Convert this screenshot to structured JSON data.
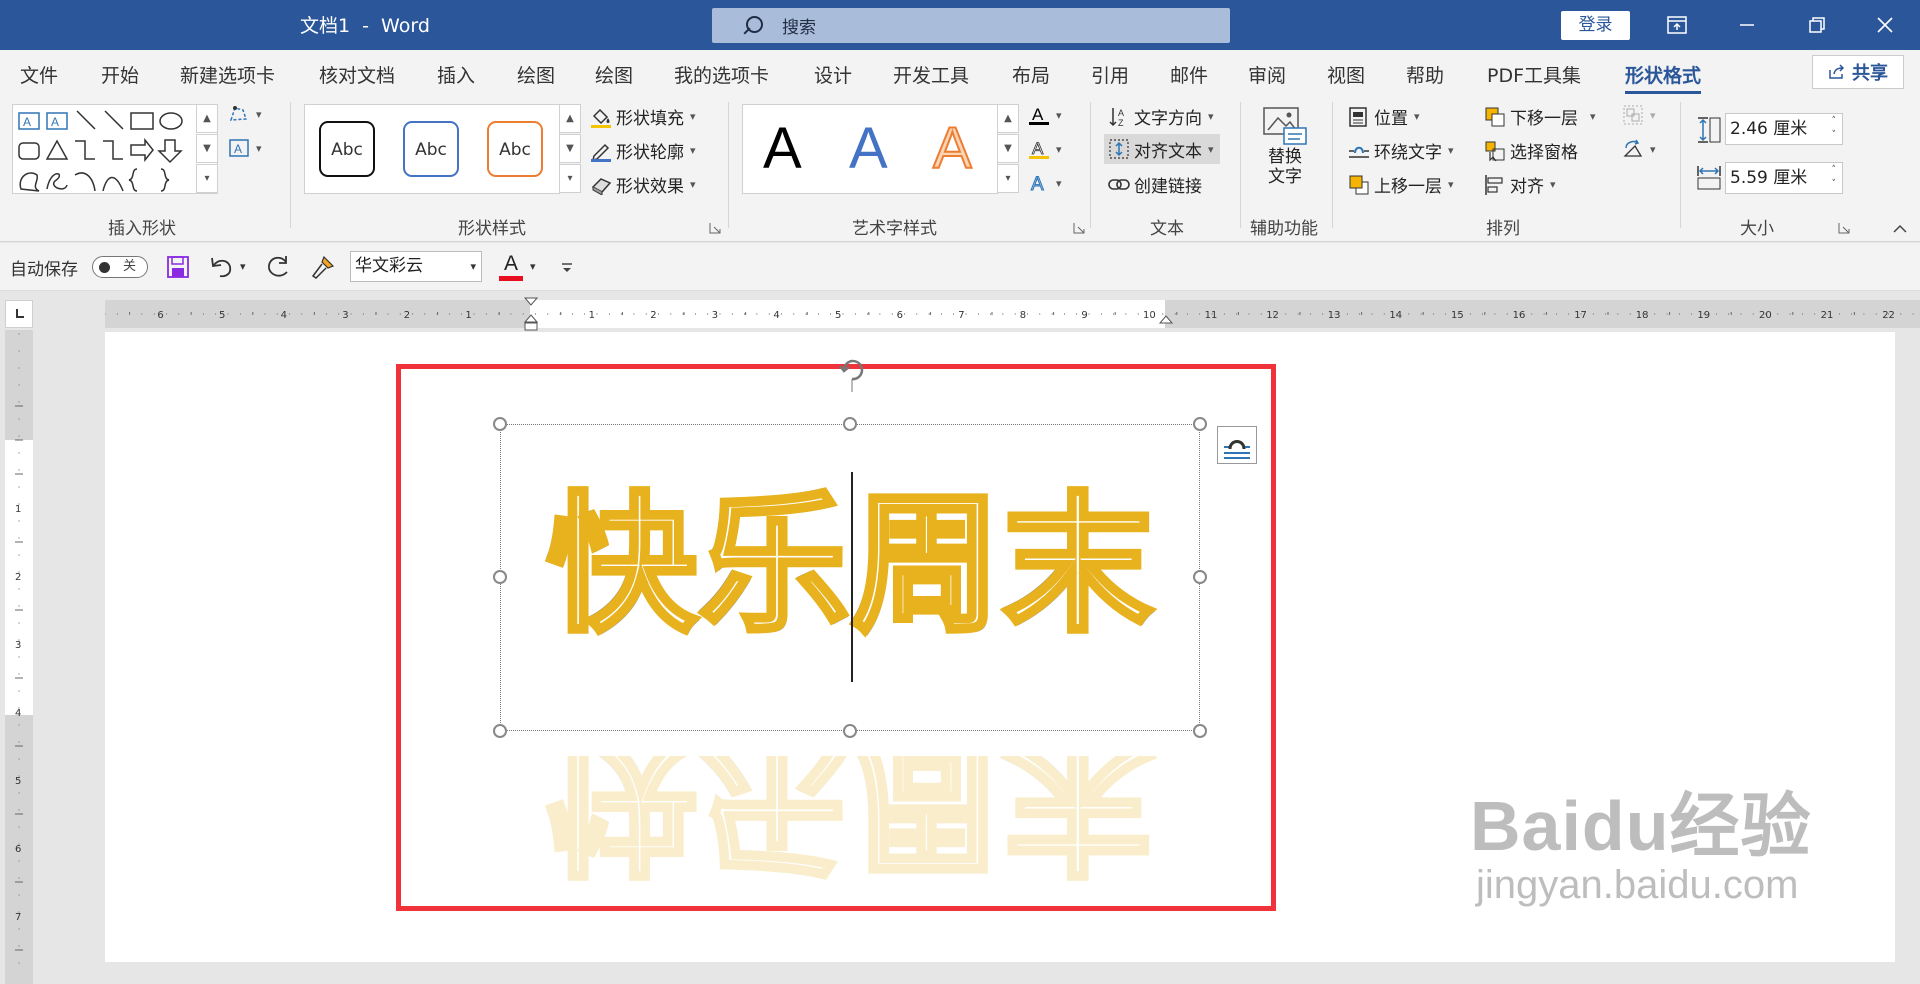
{
  "titlebar": {
    "doc_name": "文档1",
    "separator": "-",
    "app_name": "Word",
    "search_placeholder": "搜索",
    "login": "登录"
  },
  "menu": {
    "tabs": [
      "文件",
      "开始",
      "新建选项卡",
      "核对文档",
      "插入",
      "绘图",
      "绘图",
      "我的选项卡",
      "设计",
      "开发工具",
      "布局",
      "引用",
      "邮件",
      "审阅",
      "视图",
      "帮助",
      "PDF工具集",
      "形状格式"
    ],
    "active_tab": "形状格式",
    "share": "共享"
  },
  "ribbon": {
    "insert_shapes": {
      "label": "插入形状"
    },
    "shape_styles": {
      "label": "形状样式",
      "presets": [
        "Abc",
        "Abc",
        "Abc"
      ],
      "fill": "形状填充",
      "outline": "形状轮廓",
      "effects": "形状效果"
    },
    "wordart_styles": {
      "label": "艺术字样式",
      "presets": [
        "A",
        "A",
        "A"
      ]
    },
    "text": {
      "label": "文本",
      "direction": "文字方向",
      "align": "对齐文本",
      "link": "创建链接"
    },
    "accessibility": {
      "label": "辅助功能",
      "alt_text_line1": "替换",
      "alt_text_line2": "文字"
    },
    "arrange": {
      "label": "排列",
      "position": "位置",
      "wrap": "环绕文字",
      "bring_forward": "上移一层",
      "send_backward": "下移一层",
      "selection_pane": "选择窗格",
      "align": "对齐"
    },
    "size": {
      "label": "大小",
      "height": "2.46 厘米",
      "width": "5.59 厘米"
    }
  },
  "qat": {
    "autosave_label": "自动保存",
    "autosave_state": "关",
    "font": "华文彩云",
    "font_color_letter": "A"
  },
  "document": {
    "wordart_chars": [
      "快",
      "乐",
      "周",
      "末"
    ]
  },
  "watermark": {
    "brand": "Baidu经验",
    "url": "jingyan.baidu.com"
  },
  "colors": {
    "title_bar": "#2b579a",
    "frame_red": "#f0323a",
    "wordart_outline": "#e8b21e"
  }
}
